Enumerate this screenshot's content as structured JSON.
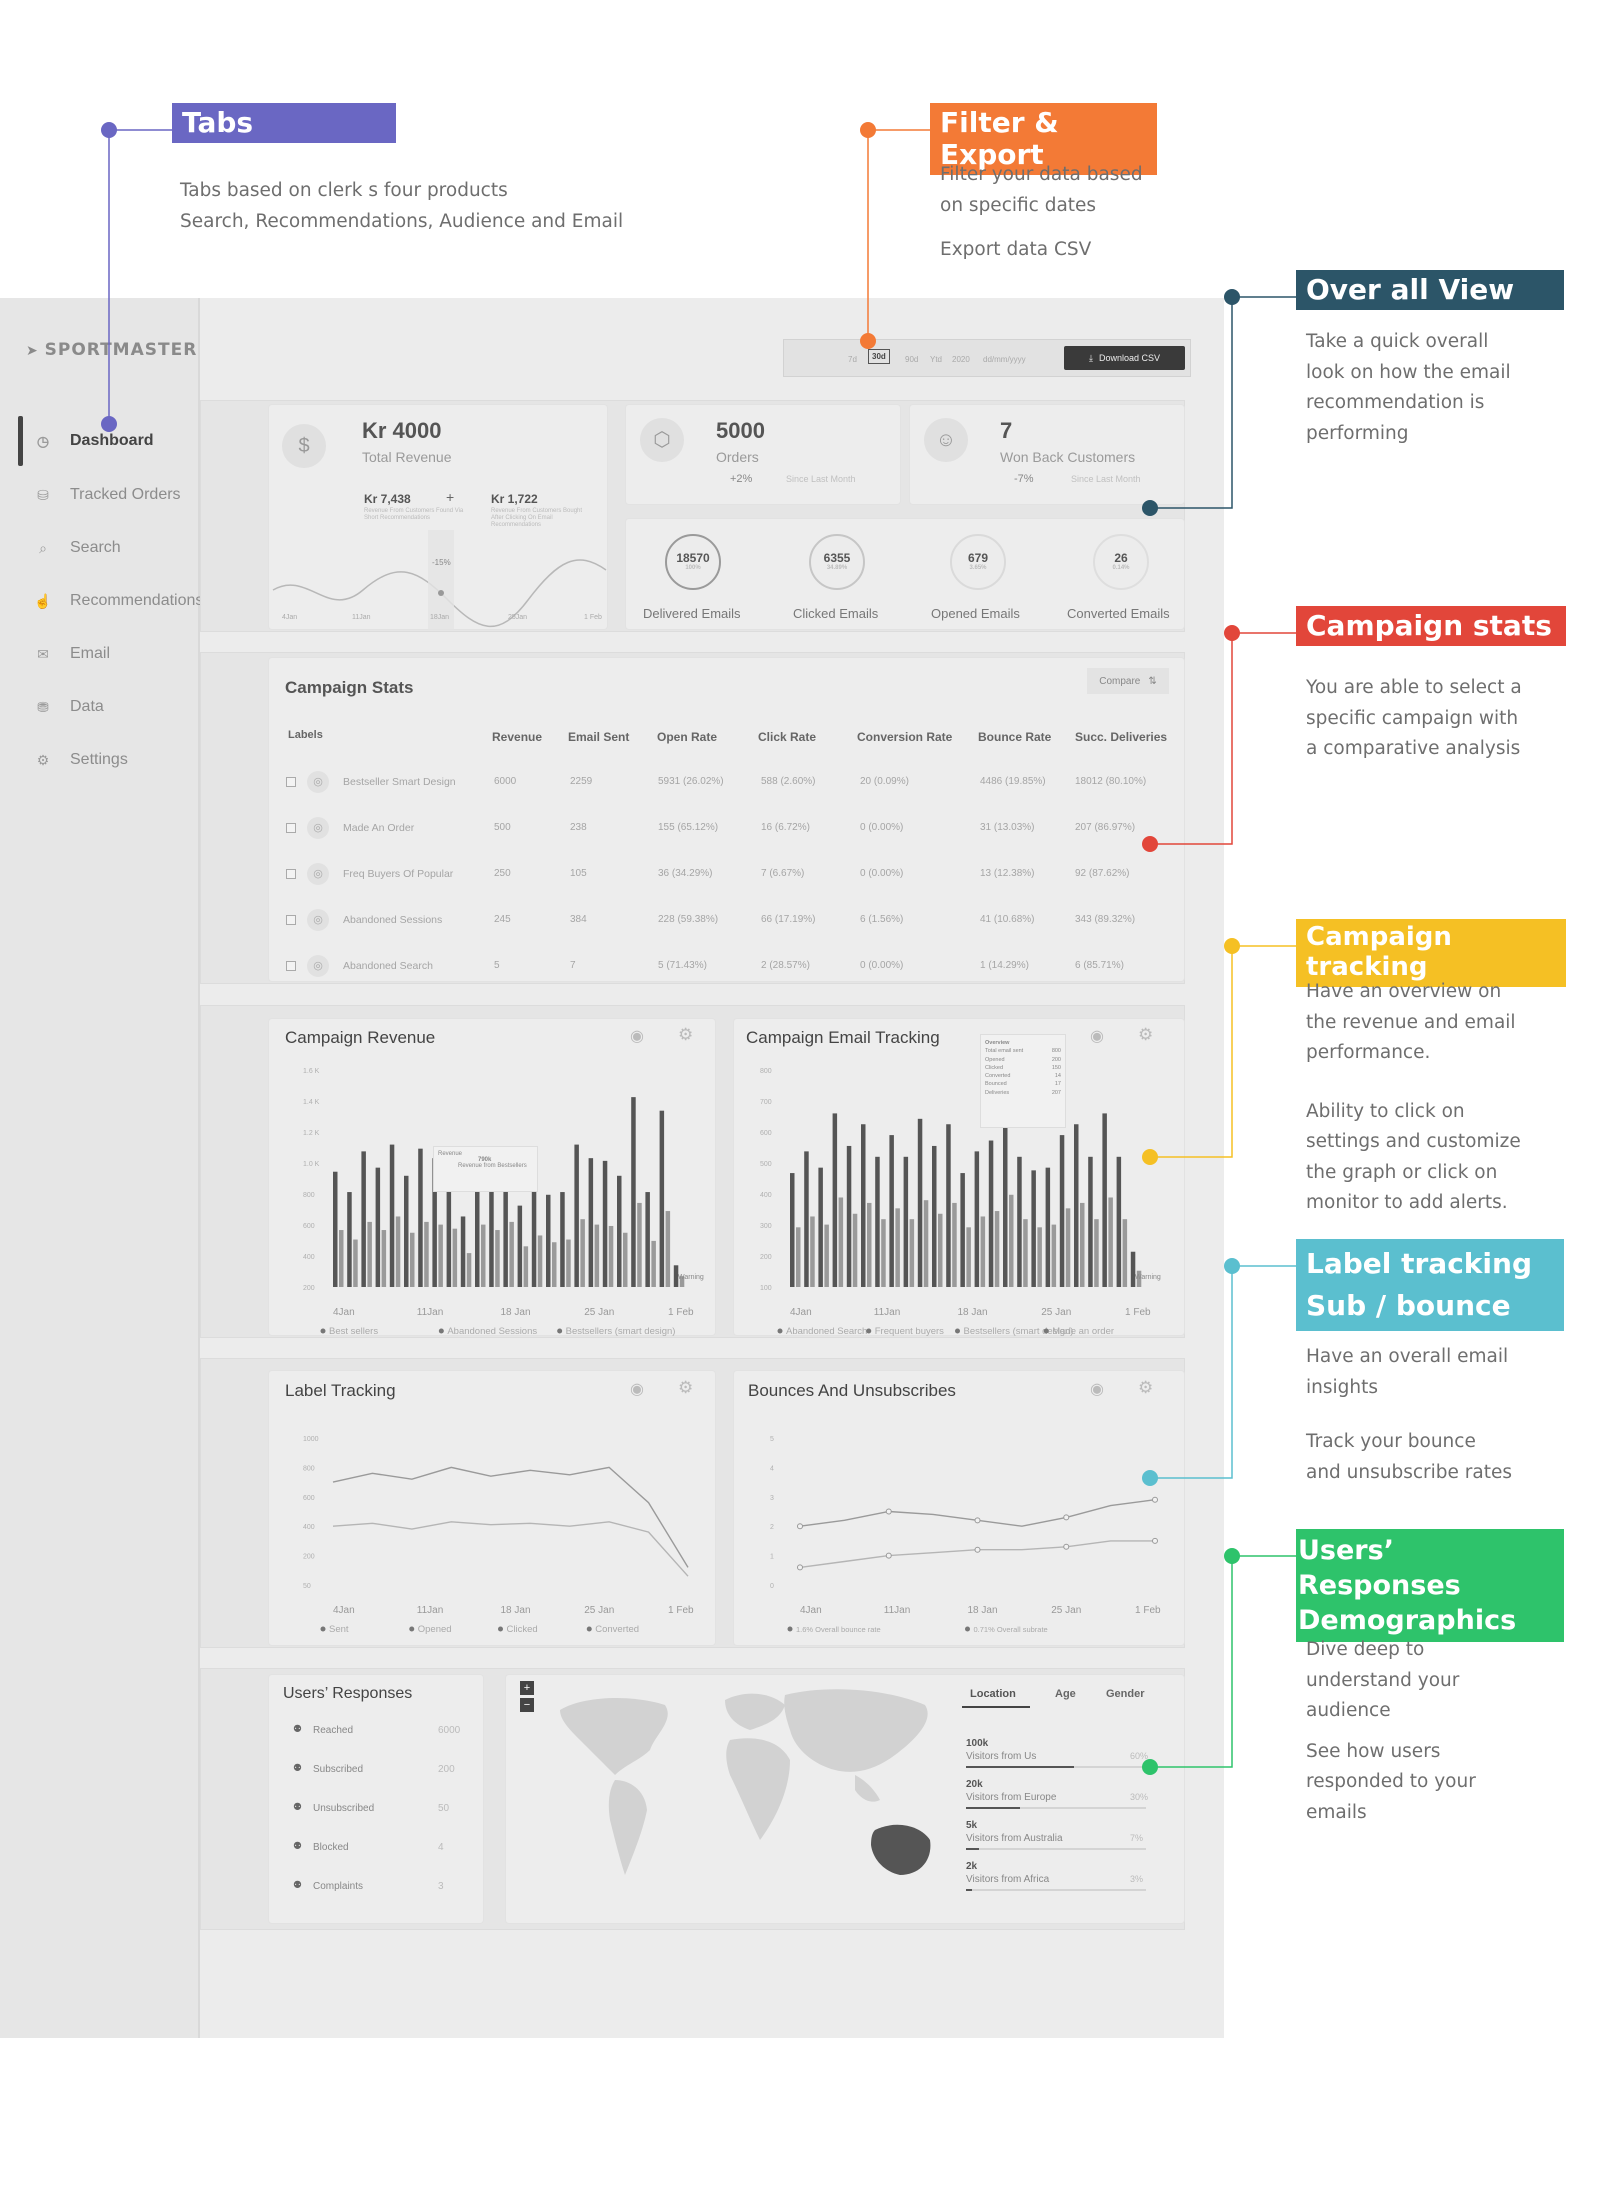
{
  "callouts": {
    "tabs": {
      "title": "Tabs",
      "desc": "Tabs based on clerk s four products\nSearch, Recommendations, Audience and Email",
      "color": "#6a67c3"
    },
    "filter": {
      "title": "Filter & Export",
      "desc1": "Filter your data based\non specific dates",
      "desc2": "Export data CSV",
      "color": "#f37a36"
    },
    "overall": {
      "title": "Over all View",
      "desc": "Take a quick overall\nlook on how the email\nrecommendation is\nperforming",
      "color": "#2c5568"
    },
    "campaign_stats": {
      "title": "Campaign stats",
      "desc": "You are able to select a\nspecific campaign with\na comparative analysis",
      "color": "#e2463a"
    },
    "campaign_tracking": {
      "title": "Campaign tracking",
      "desc1": "Have an overview on\nthe revenue and email\nperformance.",
      "desc2": "Ability to click on\nsettings and customize\nthe graph or click on\nmonitor to add alerts.",
      "color": "#f5c024"
    },
    "label_tracking": {
      "title1": "Label tracking",
      "title2": "Sub / bounce",
      "desc1": "Have an overall email\ninsights",
      "desc2": "Track your bounce\nand unsubscribe rates",
      "color": "#5bbfcf"
    },
    "users": {
      "title1": "Users’ Responses",
      "title2": "Demographics",
      "desc1": "Dive deep to\nunderstand your\naudience",
      "desc2": "See how users\nresponded to your\nemails",
      "color": "#2ec36b"
    }
  },
  "sidebar": {
    "logo": "SPORTMASTER",
    "items": [
      {
        "label": "Dashboard",
        "icon": "clock-icon"
      },
      {
        "label": "Tracked Orders",
        "icon": "bag-icon"
      },
      {
        "label": "Search",
        "icon": "search-icon"
      },
      {
        "label": "Recommendations",
        "icon": "thumb-icon"
      },
      {
        "label": "Email",
        "icon": "mail-icon"
      },
      {
        "label": "Data",
        "icon": "database-icon"
      },
      {
        "label": "Settings",
        "icon": "gear-icon"
      }
    ]
  },
  "filter_bar": {
    "options": [
      "7d",
      "30d",
      "90d",
      "Ytd",
      "2020",
      "dd/mm/yyyy"
    ],
    "selected": "30d",
    "download_label": "Download CSV"
  },
  "revenue_card": {
    "value": "Kr 4000",
    "label": "Total Revenue",
    "sub1_value": "Kr 7,438",
    "sub1_desc": "Revenue From Customers Found Via Short Recommendations",
    "plus": "+",
    "sub2_value": "Kr 1,722",
    "sub2_desc": "Revenue From Customers Bought After Clicking On Email Recommendations",
    "marker": "-15%",
    "xticks": [
      "4Jan",
      "11Jan",
      "18Jan",
      "25Jan",
      "1 Feb"
    ]
  },
  "orders_card": {
    "value": "5000",
    "label": "Orders",
    "change": "+2%",
    "since": "Since Last Month"
  },
  "winback_card": {
    "value": "7",
    "label": "Won Back Customers",
    "change": "-7%",
    "since": "Since Last Month"
  },
  "email_stats": [
    {
      "value": "18570",
      "pct": "100%",
      "label": "Delivered Emails"
    },
    {
      "value": "6355",
      "pct": "34.89%",
      "label": "Clicked Emails"
    },
    {
      "value": "679",
      "pct": "3.65%",
      "label": "Opened Emails"
    },
    {
      "value": "26",
      "pct": "0.14%",
      "label": "Converted Emails"
    }
  ],
  "campaign_stats": {
    "title": "Campaign Stats",
    "compare_label": "Compare",
    "headers": [
      "Labels",
      "Revenue",
      "Email Sent",
      "Open Rate",
      "Click Rate",
      "Conversion Rate",
      "Bounce Rate",
      "Succ. Deliveries"
    ],
    "rows": [
      {
        "label": "Bestseller Smart Design",
        "revenue": "6000",
        "sent": "2259",
        "open": "5931  (26.02%)",
        "click": "588  (2.60%)",
        "conv": "20  (0.09%)",
        "bounce": "4486 (19.85%)",
        "succ": "18012 (80.10%)"
      },
      {
        "label": "Made An Order",
        "revenue": "500",
        "sent": "238",
        "open": "155  (65.12%)",
        "click": "16  (6.72%)",
        "conv": "0  (0.00%)",
        "bounce": "31  (13.03%)",
        "succ": "207  (86.97%)"
      },
      {
        "label": "Freq Buyers Of Popular",
        "revenue": "250",
        "sent": "105",
        "open": "36  (34.29%)",
        "click": "7  (6.67%)",
        "conv": "0  (0.00%)",
        "bounce": "13  (12.38%)",
        "succ": "92  (87.62%)"
      },
      {
        "label": "Abandoned Sessions",
        "revenue": "245",
        "sent": "384",
        "open": "228  (59.38%)",
        "click": "66  (17.19%)",
        "conv": "6  (1.56%)",
        "bounce": "41  (10.68%)",
        "succ": "343  (89.32%)"
      },
      {
        "label": "Abandoned Search",
        "revenue": "5",
        "sent": "7",
        "open": "5  (71.43%)",
        "click": "2  (28.57%)",
        "conv": "0  (0.00%)",
        "bounce": "1  (14.29%)",
        "succ": "6  (85.71%)"
      }
    ]
  },
  "chart_data": [
    {
      "type": "bar",
      "title": "Campaign Revenue",
      "yticks": [
        "1.6 K",
        "1.4 K",
        "1.2 K",
        "1.0 K",
        "800",
        "600",
        "400",
        "200"
      ],
      "ylim": [
        0,
        1600
      ],
      "xticks": [
        "4Jan",
        "11Jan",
        "18 Jan",
        "25 Jan",
        "1 Feb"
      ],
      "series": [
        {
          "name": "Best sellers",
          "values": [
            850,
            700,
            1000,
            880,
            1050,
            820,
            1020,
            950,
            900,
            520,
            920,
            870,
            1000,
            600,
            780,
            680,
            700,
            1050,
            950,
            930,
            820,
            1400,
            700,
            1300,
            160
          ]
        },
        {
          "name": "Abandoned Sessions",
          "values": [
            420,
            350,
            480,
            420,
            520,
            400,
            480,
            460,
            430,
            250,
            460,
            420,
            480,
            300,
            380,
            330,
            350,
            500,
            460,
            450,
            400,
            620,
            340,
            560,
            80
          ]
        },
        {
          "name": "Bestsellers (smart design)",
          "values": [
            0
          ]
        }
      ],
      "legend": [
        "Best sellers",
        "Abandoned Sessions",
        "Bestsellers (smart design)"
      ],
      "tooltip": {
        "title": "Revenue",
        "value": "790k",
        "desc": "Revenue from Bestsellers"
      },
      "annotation": "Warning"
    },
    {
      "type": "bar",
      "title": "Campaign Email Tracking",
      "yticks": [
        "800",
        "700",
        "600",
        "500",
        "400",
        "300",
        "200",
        "100"
      ],
      "ylim": [
        0,
        800
      ],
      "xticks": [
        "4Jan",
        "11Jan",
        "18 Jan",
        "25 Jan",
        "1 Feb"
      ],
      "series": [
        {
          "name": "Abandoned Search",
          "values": [
            420,
            500,
            440,
            640,
            520,
            600,
            480,
            560,
            480,
            620,
            520,
            600,
            420,
            500,
            540,
            660,
            480,
            430,
            440,
            560,
            600,
            480,
            640,
            480,
            130
          ]
        },
        {
          "name": "Frequent buyers",
          "values": [
            220,
            260,
            230,
            330,
            270,
            310,
            250,
            290,
            250,
            320,
            270,
            310,
            220,
            260,
            280,
            340,
            250,
            220,
            230,
            290,
            310,
            250,
            330,
            250,
            60
          ]
        },
        {
          "name": "Bestsellers (smart design)",
          "values": [
            0
          ]
        },
        {
          "name": "Made an order",
          "values": [
            0
          ]
        }
      ],
      "legend": [
        "Abandoned Search",
        "Frequent buyers",
        "Bestsellers (smart design)",
        "Made an order"
      ],
      "tooltip": {
        "title": "Overview",
        "rows": [
          [
            "Total email sent",
            "800"
          ],
          [
            "Opened",
            "200"
          ],
          [
            "Clicked",
            "150"
          ],
          [
            "Converted",
            "14"
          ],
          [
            "Bounced",
            "17"
          ],
          [
            "Deliveries",
            "207"
          ]
        ]
      },
      "annotation": "Warning"
    },
    {
      "type": "line",
      "title": "Label Tracking",
      "yticks": [
        "1000",
        "800",
        "600",
        "400",
        "200",
        "50"
      ],
      "xticks": [
        "4Jan",
        "11Jan",
        "18 Jan",
        "25 Jan",
        "1 Feb"
      ],
      "series": [
        {
          "name": "Sent",
          "values": [
            700,
            760,
            720,
            800,
            740,
            780,
            750,
            800,
            560,
            120
          ]
        },
        {
          "name": "Opened",
          "values": [
            400,
            420,
            380,
            430,
            410,
            420,
            400,
            430,
            360,
            60
          ]
        }
      ],
      "legend": [
        "Sent",
        "Opened",
        "Clicked",
        "Converted"
      ]
    },
    {
      "type": "line",
      "title": "Bounces And Unsubscribes",
      "yticks": [
        "5",
        "4",
        "3",
        "2",
        "1",
        "0"
      ],
      "xticks": [
        "4Jan",
        "11Jan",
        "18 Jan",
        "25 Jan",
        "1 Feb"
      ],
      "series": [
        {
          "name": "Overall bounce rate",
          "values": [
            2,
            2.2,
            2.5,
            2.4,
            2.2,
            2.0,
            2.3,
            2.7,
            2.9
          ]
        },
        {
          "name": "Overall subrate",
          "values": [
            0.6,
            0.8,
            1.0,
            1.1,
            1.2,
            1.2,
            1.3,
            1.5,
            1.5
          ]
        }
      ],
      "legend": [
        "1.6%  Overall bounce rate",
        "0.71%  Overall subrate"
      ]
    }
  ],
  "users_responses": {
    "title": "Users’ Responses",
    "items": [
      {
        "label": "Reached",
        "value": "6000"
      },
      {
        "label": "Subscribed",
        "value": "200"
      },
      {
        "label": "Unsubscribed",
        "value": "50"
      },
      {
        "label": "Blocked",
        "value": "4"
      },
      {
        "label": "Complaints",
        "value": "3"
      }
    ]
  },
  "demographics": {
    "tabs": [
      "Location",
      "Age",
      "Gender"
    ],
    "items": [
      {
        "value": "100k",
        "label": "Visitors from Us",
        "pct": "60%"
      },
      {
        "value": "20k",
        "label": "Visitors from Europe",
        "pct": "30%"
      },
      {
        "value": "5k",
        "label": "Visitors from Australia",
        "pct": "7%"
      },
      {
        "value": "2k",
        "label": "Visitors from  Africa",
        "pct": "3%"
      }
    ]
  }
}
